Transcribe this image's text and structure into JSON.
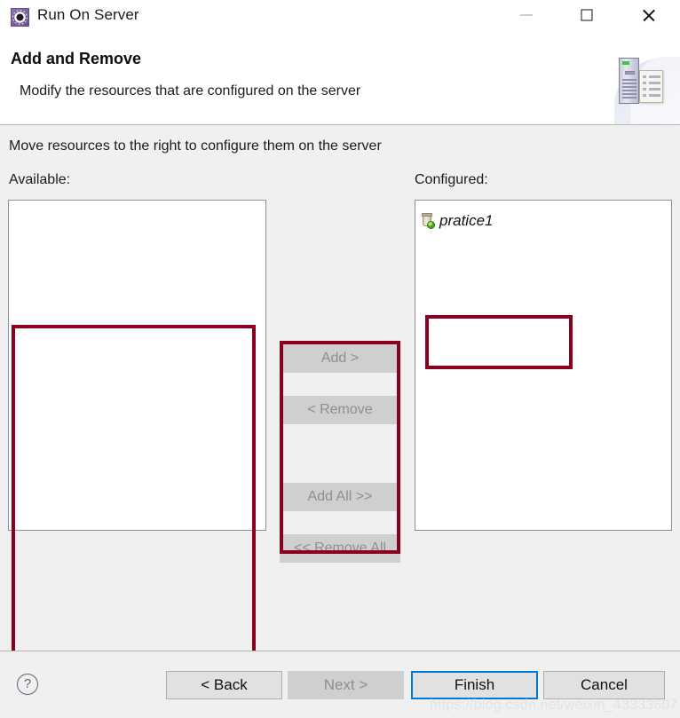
{
  "window": {
    "title": "Run On Server",
    "icon": "run-on-server-icon",
    "controls": {
      "minimize": "minimize-icon",
      "maximize": "maximize-icon",
      "close": "close-icon"
    }
  },
  "header": {
    "title": "Add and Remove",
    "subtitle": "Modify the resources that are configured on the server",
    "banner_icon": "server-and-document-banner"
  },
  "body": {
    "intro": "Move resources to the right to configure them on the server",
    "available": {
      "label": "Available:",
      "items": []
    },
    "configured": {
      "label": "Configured:",
      "items": [
        {
          "label": "pratice1",
          "icon": "dynamic-web-project-icon"
        }
      ]
    },
    "transfer_buttons": [
      {
        "label": "Add >",
        "enabled": false
      },
      {
        "label": "< Remove",
        "enabled": false
      },
      {
        "label": "Add All >>",
        "enabled": false
      },
      {
        "label": "<< Remove All",
        "enabled": false
      }
    ]
  },
  "footer": {
    "help": "?",
    "back_label": "< Back",
    "next_label": "Next >",
    "finish_label": "Finish",
    "cancel_label": "Cancel"
  },
  "watermark": "https://blog.csdn.net/weixin_43333607",
  "colors": {
    "annotation_red": "#8b0020",
    "focus_blue": "#0078d7",
    "dialog_bg": "#f0f0f0",
    "disabled_text": "#8e8e8e"
  }
}
